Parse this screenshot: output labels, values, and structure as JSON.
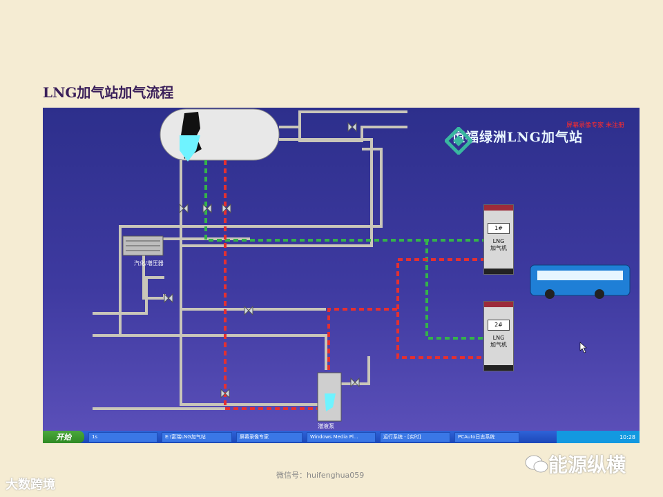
{
  "slide": {
    "title": "LNG加气站加气流程"
  },
  "scada": {
    "brand": "恒福绿洲LNG加气站",
    "notice": "屏幕录像专家 未注册",
    "labels": {
      "vaporizer": "汽化/增压器",
      "pump": "潜液泵"
    },
    "dispensers": [
      {
        "number": "1#",
        "line1": "LNG",
        "line2": "加气机"
      },
      {
        "number": "2#",
        "line1": "LNG",
        "line2": "加气机"
      }
    ]
  },
  "taskbar": {
    "start": "开始",
    "tasks": [
      "1s",
      "E:\\富瑞LNG加气站",
      "屏幕录像专家",
      "Windows Media Pl...",
      "运行系统 - [实时]",
      "PCAuto日志系统"
    ],
    "clock": "10:28"
  },
  "footer": {
    "wechat": "微信号：huifenghua059",
    "brand": "能源纵横",
    "logo": "大数跨境"
  },
  "colors": {
    "panel": "#3e3aa0",
    "pipe": "#c9c6b9",
    "red_line": "#e53030",
    "green_line": "#34b34a"
  }
}
